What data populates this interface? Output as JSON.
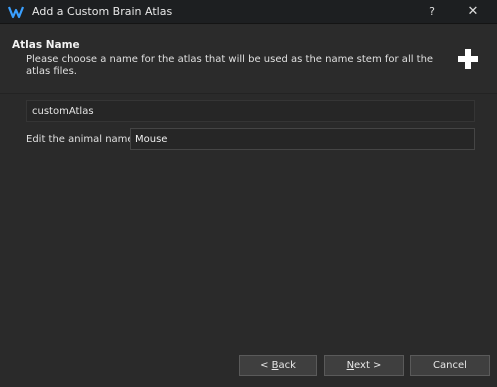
{
  "window": {
    "title": "Add a Custom Brain Atlas",
    "help_label": "?",
    "close_label": "✕"
  },
  "header": {
    "heading": "Atlas Name",
    "description": "Please choose a name for the atlas that will be used as the name stem for all the atlas files."
  },
  "form": {
    "atlas_name_value": "customAtlas",
    "animal_label": "Edit the animal name",
    "animal_value": "Mouse"
  },
  "buttons": {
    "back_lt": "< ",
    "back_underlined": "B",
    "back_rest": "ack",
    "next_underlined": "N",
    "next_rest": "ext >",
    "cancel": "Cancel"
  },
  "colors": {
    "background": "#2a2a2a",
    "titlebar": "#1d1f21",
    "button": "#3f3f3f",
    "icon_accent": "#3aa0ff"
  },
  "icons": [
    "app-logo-icon",
    "help-icon",
    "close-icon",
    "plus-icon"
  ]
}
